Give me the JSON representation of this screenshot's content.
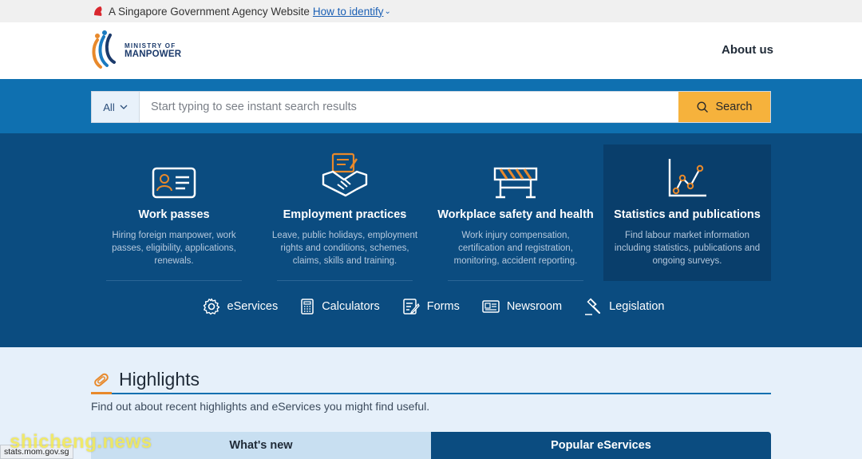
{
  "gov_bar": {
    "text": "A Singapore Government Agency Website",
    "link": "How to identify"
  },
  "header": {
    "logo_line1": "MINISTRY OF",
    "logo_line2": "MANPOWER",
    "about": "About us"
  },
  "search": {
    "scope": "All",
    "placeholder": "Start typing to see instant search results",
    "button": "Search"
  },
  "cards": [
    {
      "title": "Work passes",
      "desc": "Hiring foreign manpower, work passes, eligibility, applications, renewals."
    },
    {
      "title": "Employment practices",
      "desc": "Leave, public holidays, employment rights and conditions, schemes, claims, skills and training."
    },
    {
      "title": "Workplace safety and health",
      "desc": "Work injury compensation, certification and registration, monitoring, accident reporting."
    },
    {
      "title": "Statistics and publications",
      "desc": "Find labour market information including statistics, publications and ongoing surveys."
    }
  ],
  "quick_links": [
    {
      "label": "eServices",
      "icon": "gear-icon"
    },
    {
      "label": "Calculators",
      "icon": "calculator-icon"
    },
    {
      "label": "Forms",
      "icon": "form-icon"
    },
    {
      "label": "Newsroom",
      "icon": "newspaper-icon"
    },
    {
      "label": "Legislation",
      "icon": "gavel-icon"
    }
  ],
  "highlights": {
    "title": "Highlights",
    "subtitle": "Find out about recent highlights and eServices you might find useful.",
    "tabs": [
      "What's new",
      "Popular eServices"
    ]
  },
  "status_bar": "stats.mom.gov.sg",
  "watermark": "shicheng.news",
  "colors": {
    "search_band": "#0f70b0",
    "nav_band": "#0b4c80",
    "accent_orange": "#e8892b",
    "search_button": "#f6b23c",
    "highlights_bg": "#e6f0fa"
  }
}
